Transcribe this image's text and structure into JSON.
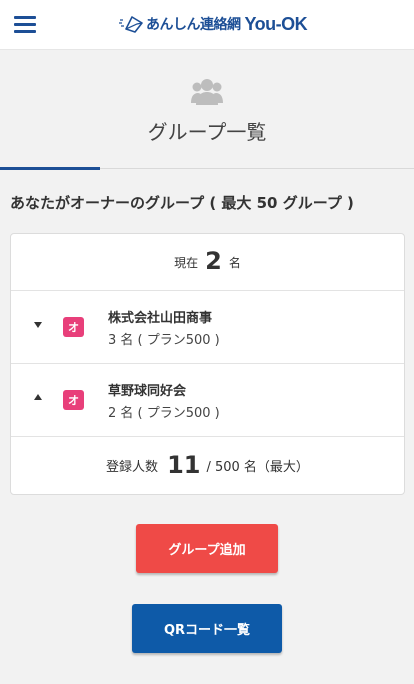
{
  "header": {
    "menu_icon": "hamburger-menu-icon",
    "logo_text": "あんしん連絡網",
    "logo_brand": "You-OK",
    "brand_color": "#1d4f96"
  },
  "page": {
    "icon": "group-icon",
    "title": "グループ一覧"
  },
  "section": {
    "title": "あなたがオーナーのグループ ( 最大 50 グループ )"
  },
  "summary": {
    "current_label": "現在",
    "current_count": "2",
    "current_unit": "名"
  },
  "groups": [
    {
      "badge": "オ",
      "name": "株式会社山田商事",
      "detail": "3 名 ( プラン500 )",
      "expanded": false
    },
    {
      "badge": "オ",
      "name": "草野球同好会",
      "detail": "2 名 ( プラン500 )",
      "expanded": true
    }
  ],
  "total": {
    "label": "登録人数",
    "count": "11",
    "rest": "/ 500 名（最大）"
  },
  "buttons": {
    "add_group": "グループ追加",
    "qr_list": "QRコード一覧"
  },
  "colors": {
    "badge": "#e83f7a",
    "add_button": "#ef4a47",
    "qr_button": "#0e5aa8"
  }
}
